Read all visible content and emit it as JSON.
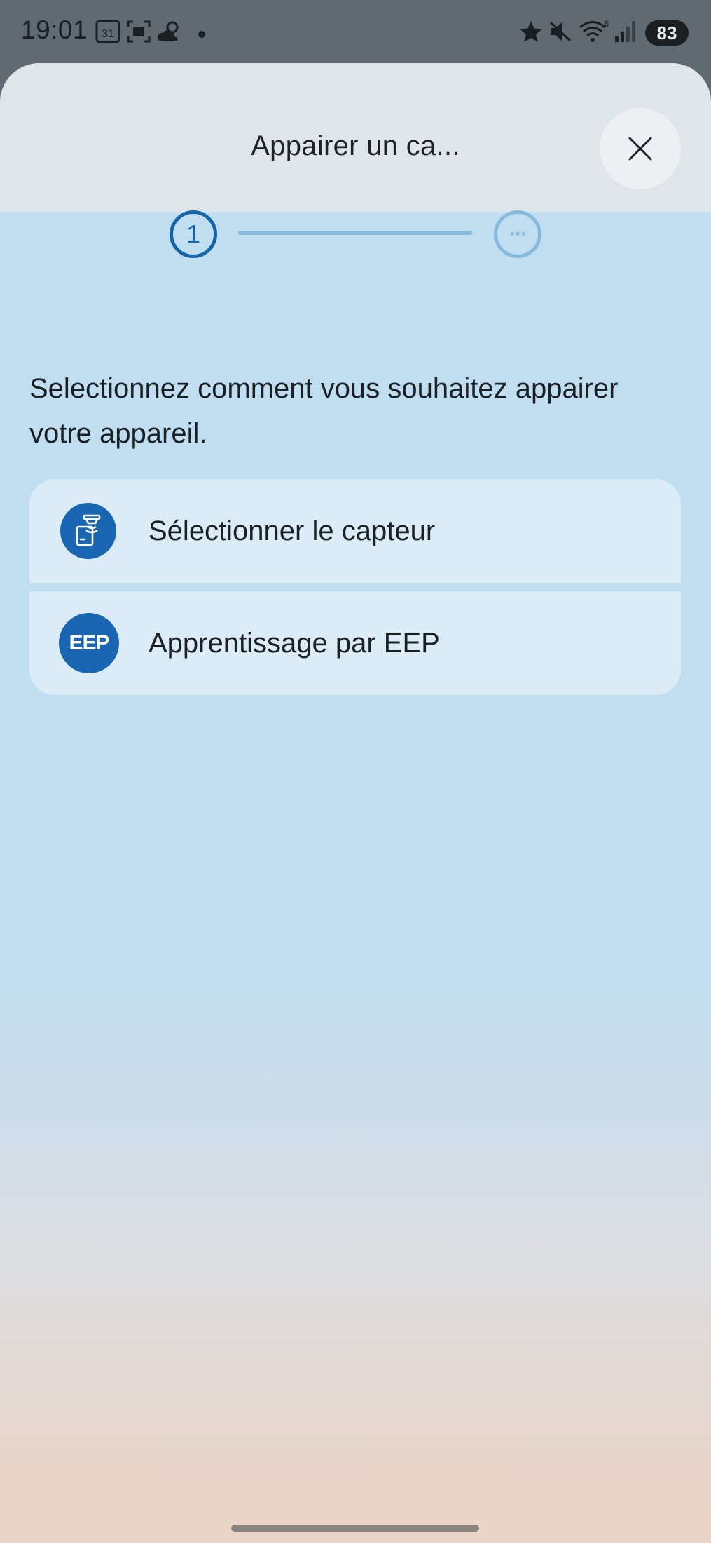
{
  "status_bar": {
    "time": "19:01",
    "calendar_day": "31",
    "battery": "83",
    "wifi_badge": "6",
    "icons": [
      "calendar-icon",
      "screenshot-icon",
      "weather-icon",
      "dot-icon",
      "star-icon",
      "mute-icon",
      "wifi-icon",
      "signal-icon"
    ]
  },
  "header": {
    "title": "Appairer un ca...",
    "close_icon": "close-icon"
  },
  "stepper": {
    "step1": "1",
    "step2": "···"
  },
  "prompt": "Selectionnez comment vous souhaitez appairer votre appareil.",
  "options": [
    {
      "label": "Sélectionner le capteur",
      "icon": "sensor-icon"
    },
    {
      "label": "Apprentissage par EEP",
      "icon_text": "EEP"
    }
  ],
  "colors": {
    "accent": "#1565a8",
    "sheet_bg": "#c1def0",
    "option_bg": "#dbecf6"
  }
}
